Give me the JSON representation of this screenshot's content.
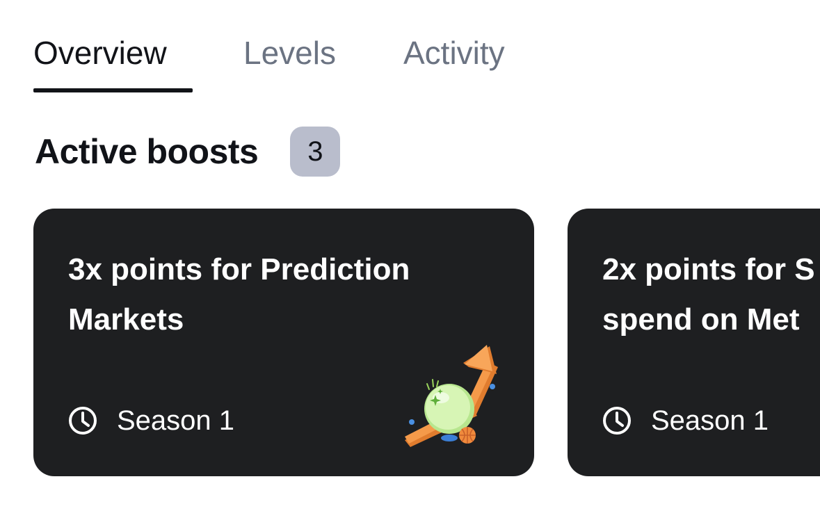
{
  "tabs": [
    {
      "label": "Overview",
      "active": true
    },
    {
      "label": "Levels",
      "active": false
    },
    {
      "label": "Activity",
      "active": false
    }
  ],
  "section": {
    "title": "Active boosts",
    "count": "3"
  },
  "cards": [
    {
      "title_line1": "3x points for Prediction",
      "title_line2": "Markets",
      "season": "Season 1",
      "icon": "clock-icon",
      "illustration": "prediction-markets-growth-illustration"
    },
    {
      "title_line1": "2x points for S",
      "title_line2": "spend on Met",
      "season": "Season 1",
      "icon": "clock-icon"
    }
  ],
  "colors": {
    "card_background": "#1e1f21",
    "badge_background": "#b9bdcc",
    "tab_inactive": "#6b7382",
    "tab_active": "#111318",
    "arrow_orange": "#f59a4a",
    "orb_green": "#d7f5b5"
  }
}
